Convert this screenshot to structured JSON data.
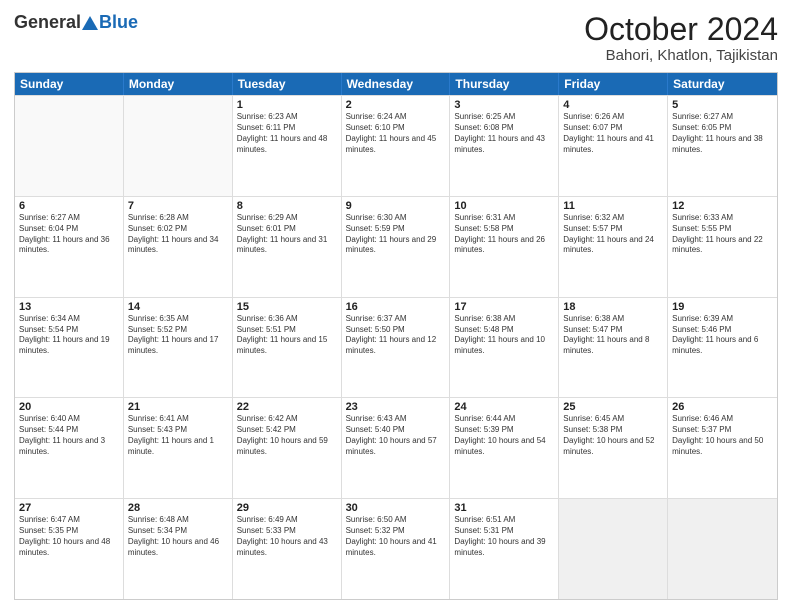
{
  "header": {
    "logo_general": "General",
    "logo_blue": "Blue",
    "month": "October 2024",
    "location": "Bahori, Khatlon, Tajikistan"
  },
  "days_of_week": [
    "Sunday",
    "Monday",
    "Tuesday",
    "Wednesday",
    "Thursday",
    "Friday",
    "Saturday"
  ],
  "rows": [
    [
      {
        "day": "",
        "sunrise": "",
        "sunset": "",
        "daylight": ""
      },
      {
        "day": "",
        "sunrise": "",
        "sunset": "",
        "daylight": ""
      },
      {
        "day": "1",
        "sunrise": "Sunrise: 6:23 AM",
        "sunset": "Sunset: 6:11 PM",
        "daylight": "Daylight: 11 hours and 48 minutes."
      },
      {
        "day": "2",
        "sunrise": "Sunrise: 6:24 AM",
        "sunset": "Sunset: 6:10 PM",
        "daylight": "Daylight: 11 hours and 45 minutes."
      },
      {
        "day": "3",
        "sunrise": "Sunrise: 6:25 AM",
        "sunset": "Sunset: 6:08 PM",
        "daylight": "Daylight: 11 hours and 43 minutes."
      },
      {
        "day": "4",
        "sunrise": "Sunrise: 6:26 AM",
        "sunset": "Sunset: 6:07 PM",
        "daylight": "Daylight: 11 hours and 41 minutes."
      },
      {
        "day": "5",
        "sunrise": "Sunrise: 6:27 AM",
        "sunset": "Sunset: 6:05 PM",
        "daylight": "Daylight: 11 hours and 38 minutes."
      }
    ],
    [
      {
        "day": "6",
        "sunrise": "Sunrise: 6:27 AM",
        "sunset": "Sunset: 6:04 PM",
        "daylight": "Daylight: 11 hours and 36 minutes."
      },
      {
        "day": "7",
        "sunrise": "Sunrise: 6:28 AM",
        "sunset": "Sunset: 6:02 PM",
        "daylight": "Daylight: 11 hours and 34 minutes."
      },
      {
        "day": "8",
        "sunrise": "Sunrise: 6:29 AM",
        "sunset": "Sunset: 6:01 PM",
        "daylight": "Daylight: 11 hours and 31 minutes."
      },
      {
        "day": "9",
        "sunrise": "Sunrise: 6:30 AM",
        "sunset": "Sunset: 5:59 PM",
        "daylight": "Daylight: 11 hours and 29 minutes."
      },
      {
        "day": "10",
        "sunrise": "Sunrise: 6:31 AM",
        "sunset": "Sunset: 5:58 PM",
        "daylight": "Daylight: 11 hours and 26 minutes."
      },
      {
        "day": "11",
        "sunrise": "Sunrise: 6:32 AM",
        "sunset": "Sunset: 5:57 PM",
        "daylight": "Daylight: 11 hours and 24 minutes."
      },
      {
        "day": "12",
        "sunrise": "Sunrise: 6:33 AM",
        "sunset": "Sunset: 5:55 PM",
        "daylight": "Daylight: 11 hours and 22 minutes."
      }
    ],
    [
      {
        "day": "13",
        "sunrise": "Sunrise: 6:34 AM",
        "sunset": "Sunset: 5:54 PM",
        "daylight": "Daylight: 11 hours and 19 minutes."
      },
      {
        "day": "14",
        "sunrise": "Sunrise: 6:35 AM",
        "sunset": "Sunset: 5:52 PM",
        "daylight": "Daylight: 11 hours and 17 minutes."
      },
      {
        "day": "15",
        "sunrise": "Sunrise: 6:36 AM",
        "sunset": "Sunset: 5:51 PM",
        "daylight": "Daylight: 11 hours and 15 minutes."
      },
      {
        "day": "16",
        "sunrise": "Sunrise: 6:37 AM",
        "sunset": "Sunset: 5:50 PM",
        "daylight": "Daylight: 11 hours and 12 minutes."
      },
      {
        "day": "17",
        "sunrise": "Sunrise: 6:38 AM",
        "sunset": "Sunset: 5:48 PM",
        "daylight": "Daylight: 11 hours and 10 minutes."
      },
      {
        "day": "18",
        "sunrise": "Sunrise: 6:38 AM",
        "sunset": "Sunset: 5:47 PM",
        "daylight": "Daylight: 11 hours and 8 minutes."
      },
      {
        "day": "19",
        "sunrise": "Sunrise: 6:39 AM",
        "sunset": "Sunset: 5:46 PM",
        "daylight": "Daylight: 11 hours and 6 minutes."
      }
    ],
    [
      {
        "day": "20",
        "sunrise": "Sunrise: 6:40 AM",
        "sunset": "Sunset: 5:44 PM",
        "daylight": "Daylight: 11 hours and 3 minutes."
      },
      {
        "day": "21",
        "sunrise": "Sunrise: 6:41 AM",
        "sunset": "Sunset: 5:43 PM",
        "daylight": "Daylight: 11 hours and 1 minute."
      },
      {
        "day": "22",
        "sunrise": "Sunrise: 6:42 AM",
        "sunset": "Sunset: 5:42 PM",
        "daylight": "Daylight: 10 hours and 59 minutes."
      },
      {
        "day": "23",
        "sunrise": "Sunrise: 6:43 AM",
        "sunset": "Sunset: 5:40 PM",
        "daylight": "Daylight: 10 hours and 57 minutes."
      },
      {
        "day": "24",
        "sunrise": "Sunrise: 6:44 AM",
        "sunset": "Sunset: 5:39 PM",
        "daylight": "Daylight: 10 hours and 54 minutes."
      },
      {
        "day": "25",
        "sunrise": "Sunrise: 6:45 AM",
        "sunset": "Sunset: 5:38 PM",
        "daylight": "Daylight: 10 hours and 52 minutes."
      },
      {
        "day": "26",
        "sunrise": "Sunrise: 6:46 AM",
        "sunset": "Sunset: 5:37 PM",
        "daylight": "Daylight: 10 hours and 50 minutes."
      }
    ],
    [
      {
        "day": "27",
        "sunrise": "Sunrise: 6:47 AM",
        "sunset": "Sunset: 5:35 PM",
        "daylight": "Daylight: 10 hours and 48 minutes."
      },
      {
        "day": "28",
        "sunrise": "Sunrise: 6:48 AM",
        "sunset": "Sunset: 5:34 PM",
        "daylight": "Daylight: 10 hours and 46 minutes."
      },
      {
        "day": "29",
        "sunrise": "Sunrise: 6:49 AM",
        "sunset": "Sunset: 5:33 PM",
        "daylight": "Daylight: 10 hours and 43 minutes."
      },
      {
        "day": "30",
        "sunrise": "Sunrise: 6:50 AM",
        "sunset": "Sunset: 5:32 PM",
        "daylight": "Daylight: 10 hours and 41 minutes."
      },
      {
        "day": "31",
        "sunrise": "Sunrise: 6:51 AM",
        "sunset": "Sunset: 5:31 PM",
        "daylight": "Daylight: 10 hours and 39 minutes."
      },
      {
        "day": "",
        "sunrise": "",
        "sunset": "",
        "daylight": ""
      },
      {
        "day": "",
        "sunrise": "",
        "sunset": "",
        "daylight": ""
      }
    ]
  ]
}
